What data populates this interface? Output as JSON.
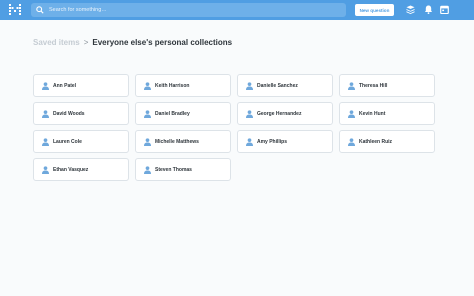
{
  "header": {
    "search_placeholder": "Search for something…",
    "new_question_label": "New question"
  },
  "breadcrumb": {
    "parent": "Saved items",
    "separator": ">",
    "current": "Everyone else's personal collections"
  },
  "collections": [
    {
      "name": "Ann Patel"
    },
    {
      "name": "Keith Harrison"
    },
    {
      "name": "Danielle Sanchez"
    },
    {
      "name": "Theresa Hill"
    },
    {
      "name": "David Woods"
    },
    {
      "name": "Daniel Bradley"
    },
    {
      "name": "George Hernandez"
    },
    {
      "name": "Kevin Hunt"
    },
    {
      "name": "Lauren Cole"
    },
    {
      "name": "Michelle Matthews"
    },
    {
      "name": "Amy Phillips"
    },
    {
      "name": "Kathleen Ruiz"
    },
    {
      "name": "Ethan Vasquez"
    },
    {
      "name": "Steven Thomas"
    }
  ],
  "icons": {
    "logo": "metabase-logo-icon",
    "search": "search-icon",
    "data": "database-icon",
    "notifications": "bell-icon",
    "activity": "calendar-icon",
    "user": "user-icon"
  },
  "colors": {
    "brand": "#509ee3",
    "text": "#2e353b",
    "muted": "#c5ccd3",
    "user_icon": "#6fa8dc"
  }
}
